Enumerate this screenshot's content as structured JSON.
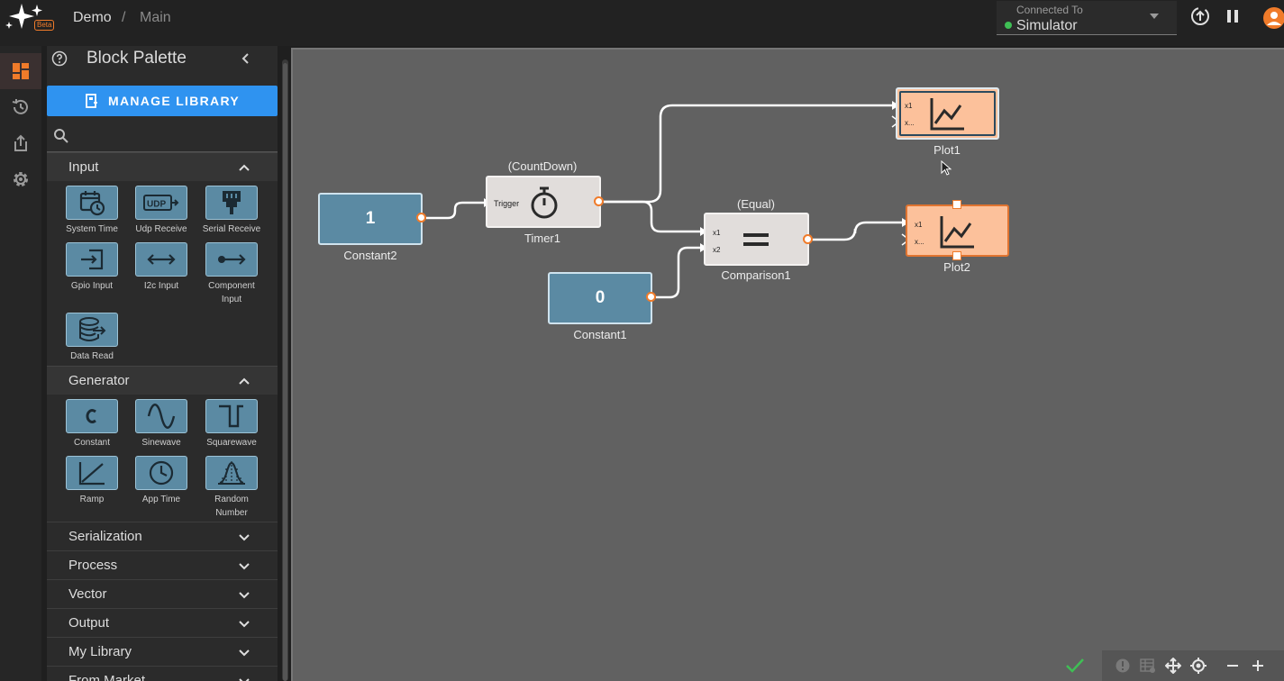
{
  "app": {
    "beta_badge": "Beta"
  },
  "breadcrumb": {
    "project": "Demo",
    "separator": "/",
    "page": "Main"
  },
  "connection": {
    "label": "Connected To",
    "value": "Simulator",
    "status_color": "#3fbf55"
  },
  "rail": {
    "items": [
      "dashboard-icon",
      "history-icon",
      "share-icon",
      "settings-icon"
    ],
    "active": 0
  },
  "palette": {
    "title": "Block Palette",
    "manage_label": "MANAGE LIBRARY",
    "search_placeholder": "",
    "sections": {
      "input": {
        "label": "Input",
        "blocks": [
          "System Time",
          "Udp Receive",
          "Serial Receive",
          "Gpio Input",
          "I2c Input",
          "Component Input",
          "Data Read"
        ]
      },
      "generator": {
        "label": "Generator",
        "blocks": [
          "Constant",
          "Sinewave",
          "Squarewave",
          "Ramp",
          "App Time",
          "Random Number"
        ]
      },
      "collapsed": [
        "Serialization",
        "Process",
        "Vector",
        "Output",
        "My Library",
        "From Market"
      ]
    }
  },
  "canvas": {
    "nodes": {
      "constant2": {
        "value": "1",
        "label": "Constant2"
      },
      "constant1": {
        "value": "0",
        "label": "Constant1"
      },
      "timer1": {
        "mode": "(CountDown)",
        "port": "Trigger",
        "label": "Timer1"
      },
      "comparison1": {
        "mode": "(Equal)",
        "port1": "x1",
        "port2": "x2",
        "label": "Comparison1"
      },
      "plot1": {
        "port1": "x1",
        "port2": "x...",
        "label": "Plot1"
      },
      "plot2": {
        "port1": "x1",
        "port2": "x...",
        "label": "Plot2"
      }
    }
  },
  "colors": {
    "accent": "#f07b2a",
    "primary_button": "#2f93f0",
    "block_fill": "#5b8aa3",
    "plot_fill": "#fcc19b",
    "selection": "#e07430"
  }
}
